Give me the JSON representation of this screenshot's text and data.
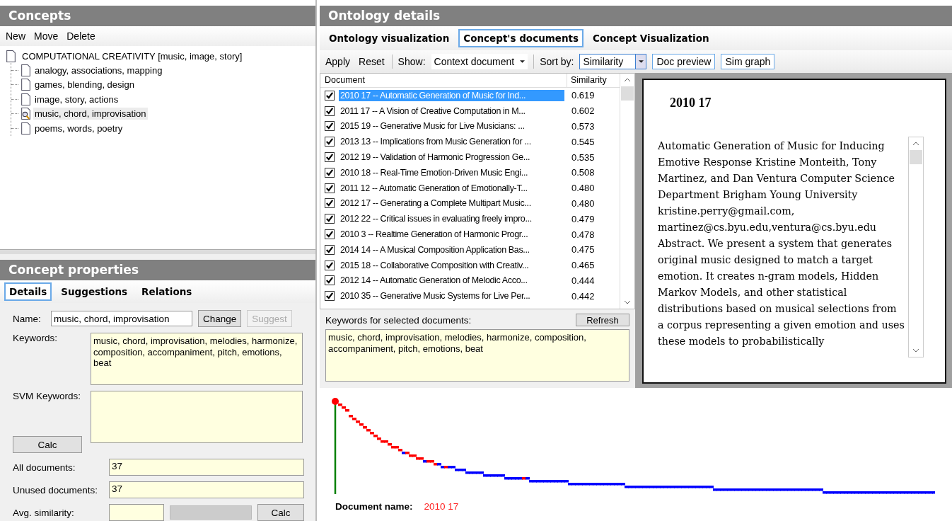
{
  "concepts": {
    "title": "Concepts",
    "menu": [
      "New",
      "Move",
      "Delete"
    ],
    "tree": {
      "label": "COMPUTATIONAL CREATIVITY [music, image, story]",
      "selected": false,
      "children": [
        {
          "label": "analogy, associations, mapping",
          "selected": false
        },
        {
          "label": "games, blending, design",
          "selected": false
        },
        {
          "label": "image, story, actions",
          "selected": false
        },
        {
          "label": "music, chord, improvisation",
          "selected": true
        },
        {
          "label": "poems, words, poetry",
          "selected": false
        }
      ]
    }
  },
  "properties": {
    "title": "Concept properties",
    "tabs": [
      {
        "label": "Details",
        "selected": true
      },
      {
        "label": "Suggestions",
        "selected": false
      },
      {
        "label": "Relations",
        "selected": false
      }
    ],
    "name_label": "Name:",
    "name_value": "music, chord, improvisation",
    "change_button": {
      "label": "Change",
      "disabled": false
    },
    "suggest_button": {
      "label": "Suggest",
      "disabled": true
    },
    "keywords_label": "Keywords:",
    "keywords": "music, chord, improvisation, melodies, harmonize, composition, accompaniment, pitch, emotions, beat",
    "svm_label": "SVM Keywords:",
    "svm_calc": "Calc",
    "all_docs_label": "All documents:",
    "all_docs": "37",
    "unused_label": "Unused documents:",
    "unused": "37",
    "avg_label": "Avg. similarity:",
    "avg_calc": "Calc"
  },
  "details": {
    "title": "Ontology details",
    "tabs": [
      {
        "label": "Ontology visualization",
        "selected": false
      },
      {
        "label": "Concept's documents",
        "selected": true
      },
      {
        "label": "Concept Visualization",
        "selected": false
      }
    ],
    "toolbar": {
      "apply": "Apply",
      "reset": "Reset",
      "show_label": "Show:",
      "show_value": "Context document",
      "sort_label": "Sort by:",
      "sort_value": "Similarity",
      "doc_preview": "Doc preview",
      "sim_graph": "Sim graph"
    },
    "table": {
      "columns": [
        "Document",
        "Similarity"
      ],
      "rows": [
        {
          "document": "2010 17 -- Automatic Generation of Music for Ind...",
          "similarity": "0.619",
          "checked": true,
          "selected": true
        },
        {
          "document": "2011 17 -- A Vision of Creative Computation in M...",
          "similarity": "0.602",
          "checked": true,
          "selected": false
        },
        {
          "document": "2015 19 -- Generative Music for Live Musicians: ...",
          "similarity": "0.573",
          "checked": true,
          "selected": false
        },
        {
          "document": "2013 13 -- Implications from Music Generation for ...",
          "similarity": "0.545",
          "checked": true,
          "selected": false
        },
        {
          "document": "2012 19 -- Validation of Harmonic Progression Ge...",
          "similarity": "0.535",
          "checked": true,
          "selected": false
        },
        {
          "document": "2010 18 -- Real-Time Emotion-Driven Music Engi...",
          "similarity": "0.508",
          "checked": true,
          "selected": false
        },
        {
          "document": "2011 12 -- Automatic Generation of Emotionally-T...",
          "similarity": "0.480",
          "checked": true,
          "selected": false
        },
        {
          "document": "2012 17 -- Generating a Complete Multipart Music...",
          "similarity": "0.480",
          "checked": true,
          "selected": false
        },
        {
          "document": "2012 22 -- Critical issues in evaluating freely impro...",
          "similarity": "0.479",
          "checked": true,
          "selected": false
        },
        {
          "document": "2010 3 -- Realtime Generation of Harmonic Progr...",
          "similarity": "0.478",
          "checked": true,
          "selected": false
        },
        {
          "document": "2014 14 -- A Musical Composition Application Bas...",
          "similarity": "0.475",
          "checked": true,
          "selected": false
        },
        {
          "document": "2015 18 -- Collaborative Composition with Creativ...",
          "similarity": "0.465",
          "checked": true,
          "selected": false
        },
        {
          "document": "2012 14 -- Automatic Generation of Melodic Acco...",
          "similarity": "0.444",
          "checked": true,
          "selected": false
        },
        {
          "document": "2010 35 -- Generative Music Systems for Live Per...",
          "similarity": "0.442",
          "checked": true,
          "selected": false
        }
      ]
    },
    "keywords_label": "Keywords for selected documents:",
    "refresh": "Refresh",
    "keywords": "music, chord, improvisation, melodies, harmonize, composition, accompaniment, pitch, emotions, beat",
    "preview": {
      "title": "2010 17",
      "text": "Automatic Generation of Music for Inducing Emotive Response Kristine Monteith, Tony Martinez, and Dan Ventura Computer Science Department Brigham Young University kristine.perry@gmail.com, martinez@cs.byu.edu,ventura@cs.byu.edu Abstract. We present a system that generates original music designed to match a target emotion. It creates n-gram models, Hidden Markov Models, and other statistical distributions based on musical selections from a corpus representing a given emotion and uses these models to probabilistically"
    },
    "doc_name_label": "Document name:",
    "doc_name": "2010 17"
  }
}
